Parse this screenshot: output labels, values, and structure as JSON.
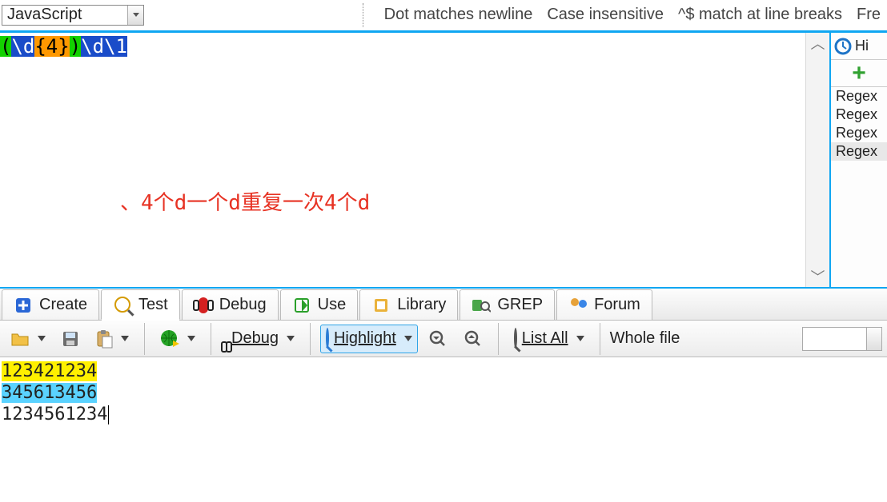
{
  "flavor": {
    "selected": "JavaScript"
  },
  "options": {
    "dot": "Dot matches newline",
    "case": "Case insensitive",
    "anchors": "^$ match at line breaks",
    "free": "Fre"
  },
  "regex": {
    "p_open": "(",
    "group_token": "\\d",
    "group_quant": "{4}",
    "p_close": ")",
    "tail_token": "\\d",
    "backref": "\\1"
  },
  "annotation": "、4个d一个d重复一次4个d",
  "scroll": {
    "up": "︿",
    "down": "﹀"
  },
  "side": {
    "head_label": "Hi",
    "items": [
      "Regex",
      "Regex",
      "Regex",
      "Regex"
    ],
    "selected_index": 3
  },
  "tabs": {
    "create": "Create",
    "test": "Test",
    "debug": "Debug",
    "use": "Use",
    "library": "Library",
    "grep": "GREP",
    "forum": "Forum",
    "active": "test"
  },
  "toolbar": {
    "debug": "Debug",
    "highlight": "Highlight",
    "list_all": "List All",
    "scope": "Whole file"
  },
  "testdata": {
    "line1": "123421234",
    "line2": "345613456",
    "line3": "1234561234"
  }
}
